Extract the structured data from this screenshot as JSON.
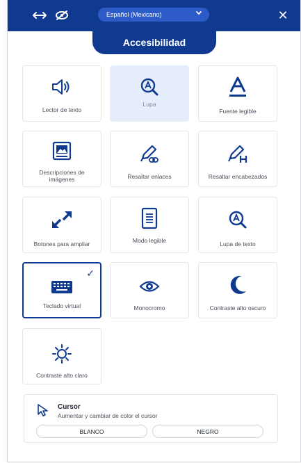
{
  "header": {
    "language_label": "Español (Mexicano)",
    "close_symbol": "✕",
    "tab_title": "Accesibilidad"
  },
  "tiles": [
    {
      "label": "Lector de texto",
      "icon": "speaker-icon"
    },
    {
      "label": "Lupa",
      "icon": "magnifier-icon",
      "state": "active"
    },
    {
      "label": "Fuente legible",
      "icon": "font-icon"
    },
    {
      "label": "Descripciones de imágenes",
      "icon": "image-icon"
    },
    {
      "label": "Resaltar enlaces",
      "icon": "pencil-link-icon"
    },
    {
      "label": "Resaltar encabezados",
      "icon": "pencil-h-icon"
    },
    {
      "label": "Botones para ampliar",
      "icon": "expand-arrows-icon"
    },
    {
      "label": "Modo legible",
      "icon": "document-icon"
    },
    {
      "label": "Lupa de texto",
      "icon": "text-magnifier-icon"
    },
    {
      "label": "Teclado virtual",
      "icon": "keyboard-icon",
      "state": "selected",
      "check": "✓"
    },
    {
      "label": "Monocromo",
      "icon": "eye-icon"
    },
    {
      "label": "Contraste alto oscuro",
      "icon": "moon-icon"
    },
    {
      "label": "Contraste alto claro",
      "icon": "sun-icon"
    }
  ],
  "cursor": {
    "title": "Cursor",
    "subtitle": "Aumentar y cambiar de color el cursor",
    "options": [
      "BLANCO",
      "NEGRO"
    ]
  },
  "colors": {
    "brand": "#0f3a8f",
    "active_bg": "#e7eefb"
  }
}
